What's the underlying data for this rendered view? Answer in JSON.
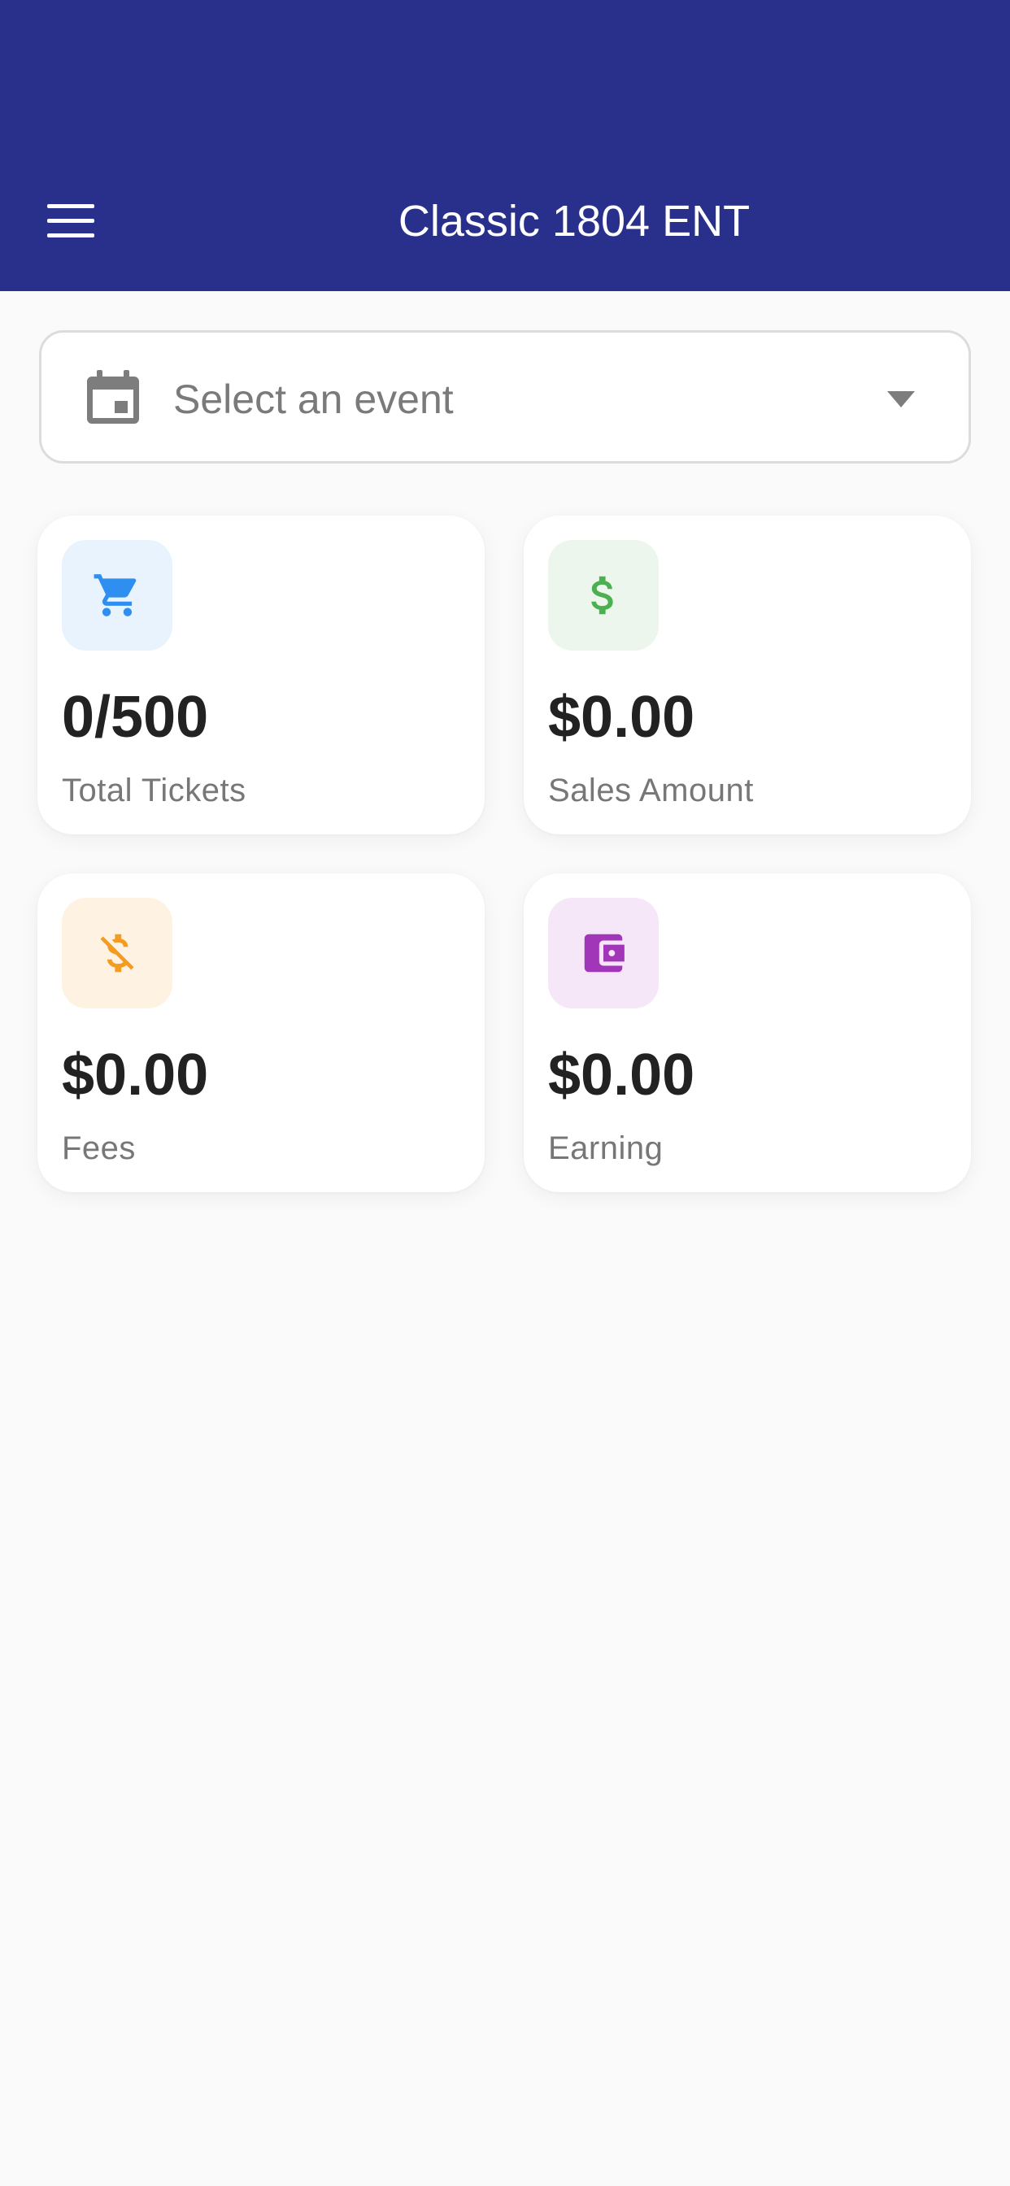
{
  "app_bar": {
    "title": "Classic 1804 ENT",
    "menu_icon": "hamburger-menu-icon",
    "background": "#29308c"
  },
  "event_select": {
    "placeholder": "Select an event",
    "leading_icon": "calendar-icon",
    "trailing_icon": "dropdown-caret-icon"
  },
  "stats": [
    {
      "value": "0/500",
      "label": "Total Tickets",
      "icon": "shopping-cart-icon",
      "icon_color": "#2f8ff0",
      "icon_bg": "#e8f3fe"
    },
    {
      "value": "$0.00",
      "label": "Sales Amount",
      "icon": "dollar-icon",
      "icon_color": "#4caf50",
      "icon_bg": "#ecf6ec"
    },
    {
      "value": "$0.00",
      "label": "Fees",
      "icon": "money-off-icon",
      "icon_color": "#f39c1f",
      "icon_bg": "#fef3e2"
    },
    {
      "value": "$0.00",
      "label": "Earning",
      "icon": "wallet-icon",
      "icon_color": "#a236b8",
      "icon_bg": "#f5e6f8"
    }
  ]
}
